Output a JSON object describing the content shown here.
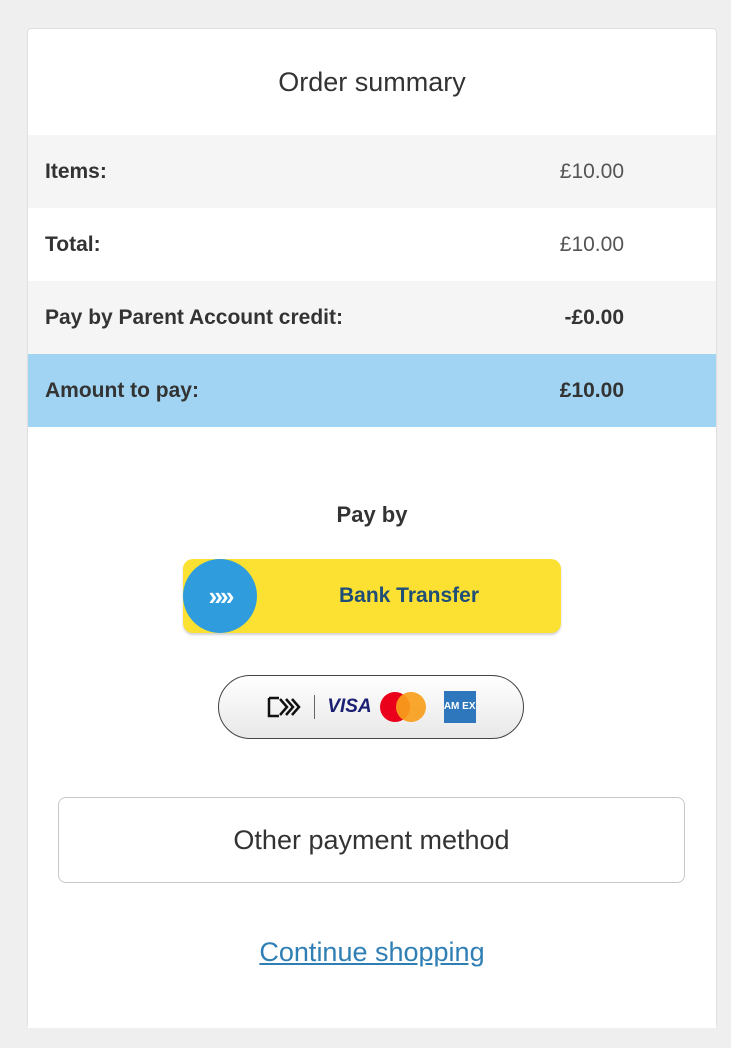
{
  "header": {
    "title": "Order summary"
  },
  "summary": {
    "rows": [
      {
        "label": "Items:",
        "value": "£10.00"
      },
      {
        "label": "Total:",
        "value": "£10.00"
      },
      {
        "label": "Pay by Parent Account credit:",
        "value": "-£0.00"
      },
      {
        "label": "Amount to pay:",
        "value": "£10.00"
      }
    ]
  },
  "payment": {
    "pay_by_label": "Pay by",
    "bank_transfer_label": "Bank Transfer",
    "bank_icon_glyph": "»»",
    "card_logos": {
      "visa": "VISA",
      "amex": "AM EX"
    },
    "other_method_label": "Other payment method",
    "continue_label": "Continue shopping"
  },
  "colors": {
    "amount_row_bg": "#a0d4f2",
    "bank_button_bg": "#fce133",
    "bank_icon_bg": "#2f9ddd",
    "link": "#2f7fb5"
  },
  "icons": [
    "chevrons-right-icon",
    "card-chevron-icon",
    "visa-logo-icon",
    "mastercard-logo-icon",
    "amex-logo-icon"
  ]
}
